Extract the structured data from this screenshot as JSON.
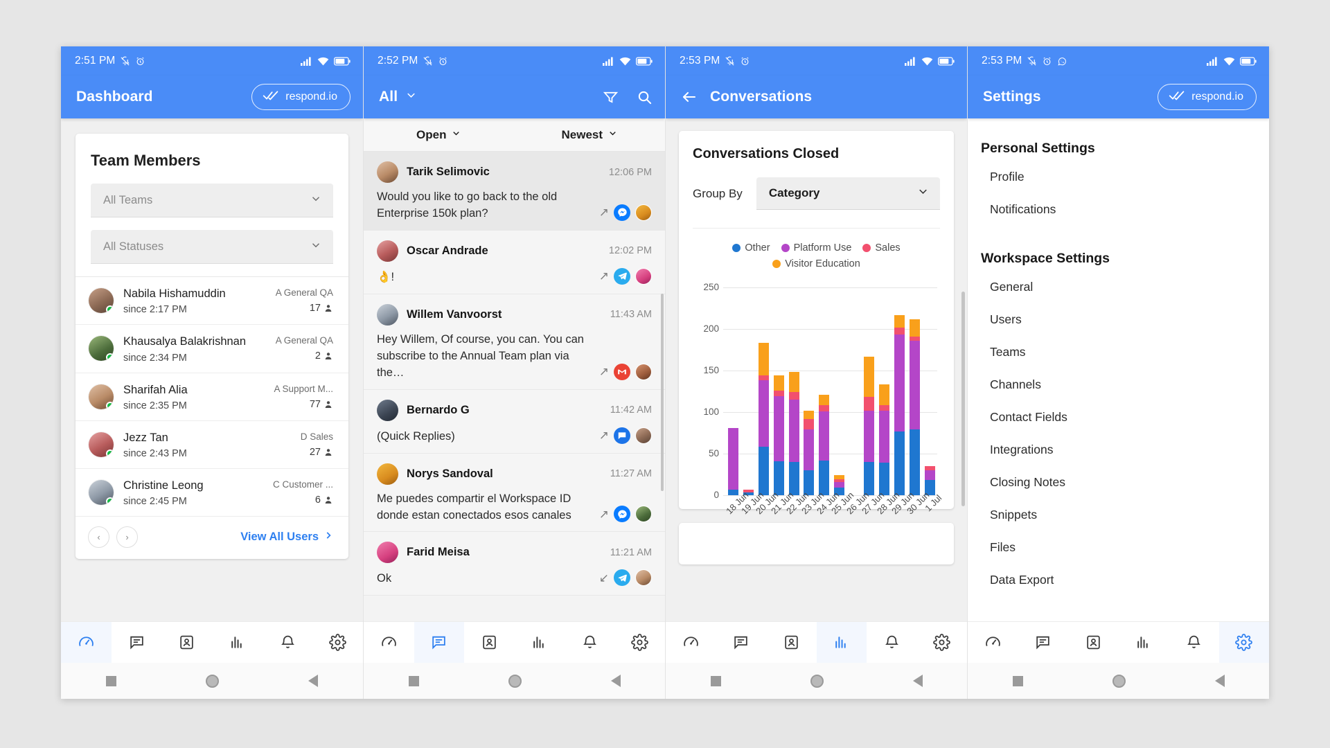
{
  "panels": {
    "dashboard": {
      "status": {
        "time": "2:51 PM",
        "icons": [
          "bell-off-icon",
          "alarm-icon"
        ],
        "right_icons": [
          "signal-icon",
          "wifi-icon",
          "battery-icon"
        ]
      },
      "appbar": {
        "title": "Dashboard",
        "brand": "respond.io"
      },
      "card": {
        "title": "Team Members",
        "filters": [
          {
            "placeholder": "All Teams",
            "value": ""
          },
          {
            "placeholder": "All Statuses",
            "value": ""
          }
        ],
        "members": [
          {
            "name": "Nabila Hishamuddin",
            "since": "since 2:17 PM",
            "team": "A General QA",
            "count": "17",
            "status": "online"
          },
          {
            "name": "Khausalya Balakrishnan",
            "since": "since 2:34 PM",
            "team": "A General QA",
            "count": "2",
            "status": "online"
          },
          {
            "name": "Sharifah Alia",
            "since": "since 2:35 PM",
            "team": "A Support M...",
            "count": "77",
            "status": "online"
          },
          {
            "name": "Jezz Tan",
            "since": "since 2:43 PM",
            "team": "D Sales",
            "count": "27",
            "status": "online"
          },
          {
            "name": "Christine Leong",
            "since": "since 2:45 PM",
            "team": "C Customer ...",
            "count": "6",
            "status": "online"
          }
        ],
        "prev_label": "‹",
        "next_label": "›",
        "view_all": "View All Users"
      },
      "nav": {
        "items": [
          "dashboard-icon",
          "messages-icon",
          "contacts-icon",
          "reports-icon",
          "notifications-icon",
          "settings-icon"
        ],
        "active": 0
      }
    },
    "conversations": {
      "status": {
        "time": "2:52 PM",
        "icons": [
          "bell-off-icon",
          "alarm-icon"
        ]
      },
      "appbar": {
        "title": "All",
        "icons": [
          "filter-icon",
          "search-icon"
        ]
      },
      "filters": [
        {
          "label": "Open"
        },
        {
          "label": "Newest"
        }
      ],
      "items": [
        {
          "name": "Tarik Selimovic",
          "time": "12:06 PM",
          "message": "Would you like to go back to the old Enterprise 150k plan?",
          "direction": "outgoing",
          "channel": "messenger",
          "active": true
        },
        {
          "name": "Oscar Andrade",
          "time": "12:02 PM",
          "message": "👌!",
          "direction": "outgoing",
          "channel": "telegram",
          "active": false
        },
        {
          "name": "Willem Vanvoorst",
          "time": "11:43 AM",
          "message": "Hey Willem, Of course, you can. You can subscribe to the Annual Team plan via the…",
          "direction": "outgoing",
          "channel": "gmail",
          "active": false
        },
        {
          "name": "Bernardo G",
          "time": "11:42 AM",
          "message": "(Quick Replies)",
          "direction": "outgoing",
          "channel": "chat",
          "active": false
        },
        {
          "name": "Norys Sandoval",
          "time": "11:27 AM",
          "message": "Me puedes compartir el Workspace ID donde estan conectados esos canales",
          "direction": "outgoing",
          "channel": "messenger",
          "active": false
        },
        {
          "name": "Farid Meisa",
          "time": "11:21 AM",
          "message": "Ok",
          "direction": "incoming",
          "channel": "telegram",
          "active": false
        }
      ],
      "nav": {
        "active": 1
      }
    },
    "reports": {
      "status": {
        "time": "2:53 PM",
        "icons": [
          "bell-off-icon",
          "alarm-icon"
        ]
      },
      "appbar": {
        "title": "Conversations",
        "back": "back-arrow-icon"
      },
      "report": {
        "title": "Conversations Closed",
        "group_by_label": "Group By",
        "group_by_value": "Category"
      },
      "nav": {
        "active": 3
      }
    },
    "settings": {
      "status": {
        "time": "2:53 PM",
        "icons": [
          "bell-off-icon",
          "alarm-icon",
          "whatsapp-icon"
        ]
      },
      "appbar": {
        "title": "Settings",
        "brand": "respond.io"
      },
      "groups": [
        {
          "title": "Personal Settings",
          "items": [
            "Profile",
            "Notifications"
          ]
        },
        {
          "title": "Workspace Settings",
          "items": [
            "General",
            "Users",
            "Teams",
            "Channels",
            "Contact Fields",
            "Integrations",
            "Closing Notes",
            "Snippets",
            "Files",
            "Data Export"
          ]
        }
      ],
      "nav": {
        "active": 5
      }
    }
  },
  "chart_data": {
    "type": "bar",
    "subtype": "stacked",
    "title": "Conversations Closed",
    "xlabel": "",
    "ylabel": "",
    "ylim": [
      0,
      250
    ],
    "yticks": [
      0,
      50,
      100,
      150,
      200,
      250
    ],
    "grid": true,
    "legend_position": "top",
    "categories": [
      "18 Jun",
      "19 Jun",
      "20 Jun",
      "21 Jun",
      "22 Jun",
      "23 Jun",
      "24 Jun",
      "25 Jun",
      "26 Jun",
      "27 Jun",
      "28 Jun",
      "29 Jun",
      "30 Jun",
      "1 Jul"
    ],
    "series": [
      {
        "name": "Other",
        "color": "#1f77d0",
        "values": [
          7,
          3,
          58,
          41,
          40,
          30,
          42,
          9,
          0,
          40,
          39,
          77,
          79,
          18
        ]
      },
      {
        "name": "Platform Use",
        "color": "#b446c8",
        "values": [
          74,
          0,
          80,
          78,
          75,
          49,
          59,
          7,
          0,
          62,
          63,
          116,
          107,
          12
        ]
      },
      {
        "name": "Sales",
        "color": "#f2506e",
        "values": [
          0,
          4,
          6,
          7,
          9,
          13,
          7,
          3,
          0,
          16,
          6,
          9,
          5,
          5
        ]
      },
      {
        "name": "Visitor Education",
        "color": "#f9a01b",
        "values": [
          0,
          0,
          39,
          18,
          24,
          10,
          13,
          5,
          0,
          49,
          25,
          15,
          21,
          0
        ]
      }
    ],
    "totals": [
      81,
      7,
      183,
      144,
      148,
      102,
      121,
      24,
      0,
      167,
      133,
      217,
      212,
      35
    ]
  }
}
